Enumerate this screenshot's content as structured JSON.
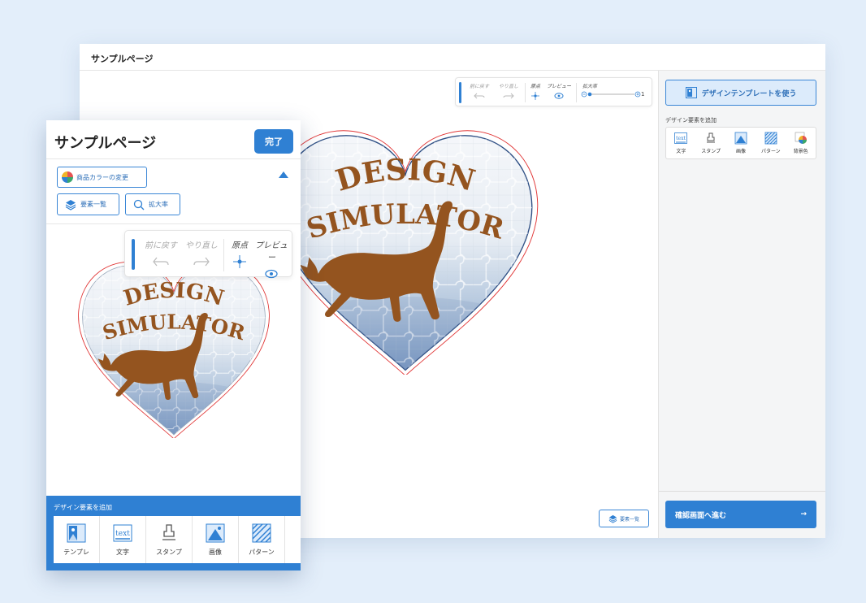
{
  "colors": {
    "accent": "#2f80d3",
    "accent_light": "#dcebfb",
    "design_text": "#94541f",
    "background": "#e3eefa"
  },
  "desktop": {
    "title": "サンプルページ",
    "toolbar": {
      "undo": "前に戻す",
      "redo": "やり直し",
      "origin": "原点",
      "preview": "プレビュー",
      "zoom": "拡大率",
      "zoom_value": "1"
    },
    "template_button": "デザインテンプレートを使う",
    "add_title": "デザイン要素を追加",
    "add_items": [
      "文字",
      "スタンプ",
      "画像",
      "パターン",
      "背景色"
    ],
    "elements_button": "要素一覧",
    "next_button": "確認画面へ進む",
    "next_arrow": "→"
  },
  "design": {
    "line1": "DESIGN",
    "line2": "SIMULATOR",
    "text_icon": "text"
  },
  "mobile": {
    "title": "サンプルページ",
    "done_button": "完了",
    "color_button": "商品カラーの変更",
    "elements_button": "要素一覧",
    "zoom_button": "拡大率",
    "toolbar": {
      "undo": "前に戻す",
      "redo": "やり直し",
      "origin": "原点",
      "preview": "プレビュー"
    },
    "add_title": "デザイン要素を追加",
    "add_items": [
      "テンプレ",
      "文字",
      "スタンプ",
      "画像",
      "パターン"
    ]
  }
}
